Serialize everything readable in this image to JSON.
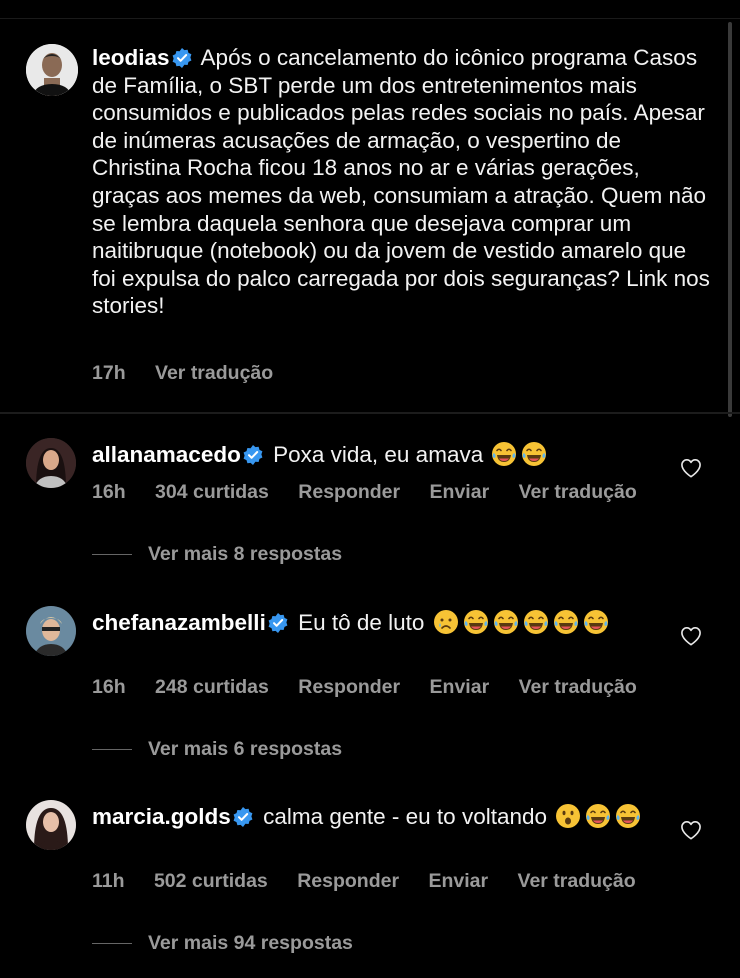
{
  "post": {
    "author": "leodias",
    "caption": "Após o cancelamento do icônico programa Casos de Família, o SBT perde um dos entretenimentos mais consumidos e publicados pelas redes sociais no país. Apesar de inúmeras acusações de armação, o vespertino de Christina Rocha ficou 18 anos no ar e várias gerações, graças aos memes da web, consumiam a atração. Quem não se lembra daquela senhora que desejava comprar um naitibruque (notebook) ou da jovem de vestido amarelo que foi expulsa do palco carregada por dois seguranças? Link nos stories!",
    "time": "17h",
    "translate": "Ver tradução"
  },
  "comments": [
    {
      "username": "allanamacedo",
      "text": "Poxa vida, eu amava",
      "time": "16h",
      "likes": "304 curtidas",
      "reply": "Responder",
      "send": "Enviar",
      "translate": "Ver tradução",
      "more_replies": "Ver mais 8 respostas"
    },
    {
      "username": "chefanazambelli",
      "text": "Eu tô de luto",
      "time": "16h",
      "likes": "248 curtidas",
      "reply": "Responder",
      "send": "Enviar",
      "translate": "Ver tradução",
      "more_replies": "Ver mais 6 respostas"
    },
    {
      "username": "marcia.golds",
      "text": "calma gente - eu to voltando",
      "time": "11h",
      "likes": "502 curtidas",
      "reply": "Responder",
      "send": "Enviar",
      "translate": "Ver tradução",
      "more_replies": "Ver mais 94 respostas"
    }
  ],
  "icons": {
    "verified": "verified-badge-icon",
    "like": "heart-icon",
    "laugh": "laughing-crying-emoji",
    "cry": "crying-emoji",
    "surprised": "surprised-emoji"
  },
  "colors": {
    "background": "#000000",
    "text": "#f2f2f2",
    "muted": "#9a9a9a",
    "verified": "#3897f0"
  }
}
